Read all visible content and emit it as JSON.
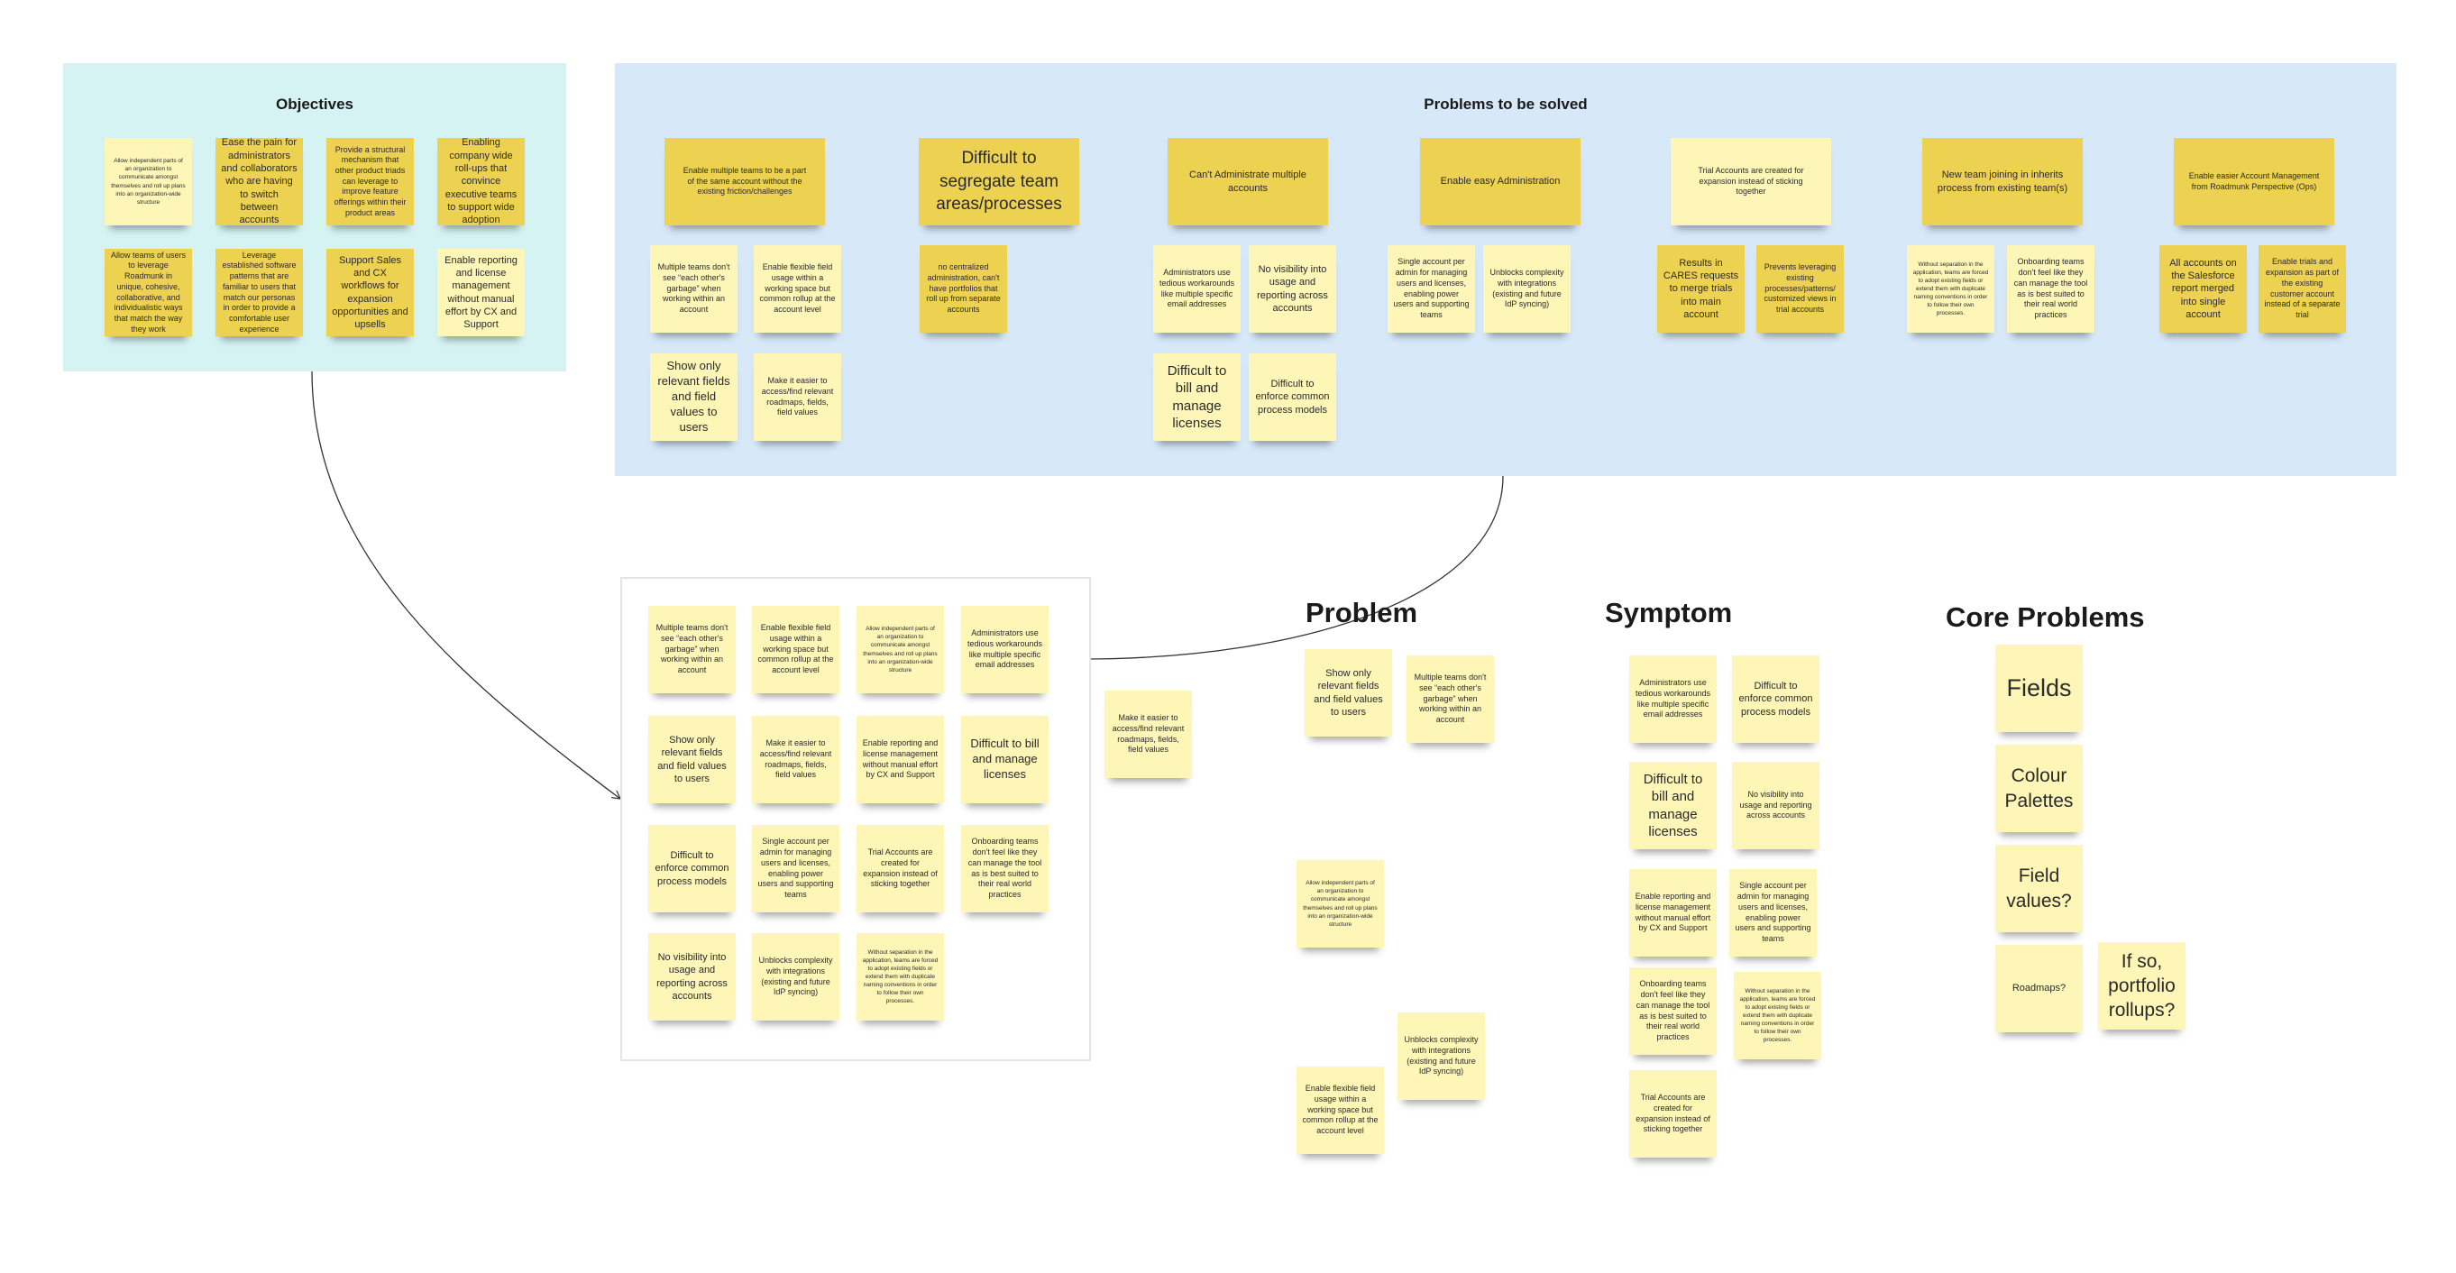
{
  "objectives": {
    "title": "Objectives",
    "notes": [
      "Allow independent parts of an organization to communicate amongst themselves and roll up plans into an organization-wide structure",
      "Ease the pain for administrators and collaborators who are having to switch between accounts",
      "Provide a structural mechanism that other product triads can leverage to improve feature offerings within their product areas",
      "Enabling company wide roll-ups that convince executive teams to support wide adoption",
      "Allow teams of users to leverage Roadmunk in unique, cohesive, collaborative, and individualistic ways that match the way they work",
      "Leverage established software patterns that are familiar to users that match our personas in order to provide a comfortable user experience",
      "Support Sales and CX workflows for expansion opportunities and upsells",
      "Enable reporting and license management without manual effort by CX and Support"
    ]
  },
  "problems": {
    "title": "Problems to be solved",
    "groups": [
      {
        "header": "Enable multiple teams to be a part of the same account without the existing friction/challenges",
        "notes": [
          "Multiple teams don't see “each other's garbage” when working within an account",
          "Enable flexible field usage within a working space but common rollup at the account level",
          "Show only relevant fields and field values to users",
          "Make it easier to access/find relevant roadmaps, fields, field values"
        ]
      },
      {
        "header": "Difficult to segregate team areas/processes",
        "notes": [
          "no centralized administration, can't have portfolios that roll up from separate accounts"
        ]
      },
      {
        "header": "Can't Administrate multiple accounts",
        "notes": [
          "Administrators use tedious workarounds like multiple specific email addresses",
          "No visibility into usage and reporting across accounts",
          "Difficult to bill and manage licenses",
          "Difficult to enforce common process models"
        ]
      },
      {
        "header": "Enable easy Administration",
        "notes": [
          "Single account per admin for managing users and licenses, enabling power users and supporting teams",
          "Unblocks complexity with integrations (existing and future IdP syncing)"
        ]
      },
      {
        "header": "Trial Accounts are created for expansion instead of sticking together",
        "notes": [
          "Results in CARES requests to merge trials into main account",
          "Prevents leveraging existing processes/patterns/ customized views in trial accounts"
        ]
      },
      {
        "header": "New team joining in inherits process from existing team(s)",
        "notes": [
          "Without separation in the application, teams are forced to adopt existing fields or extend them with duplicate naming conventions in order to follow their own processes.",
          "Onboarding teams don't feel like they can manage the tool as is best suited to their real world practices"
        ]
      },
      {
        "header": "Enable easier Account Management from Roadmunk Perspective (Ops)",
        "notes": [
          "All accounts on the Salesforce report merged into single account",
          "Enable trials and expansion as part of the existing customer account instead of a separate trial"
        ]
      }
    ]
  },
  "cluster": {
    "notes": [
      "Multiple teams don't see “each other's garbage” when working within an account",
      "Enable flexible field usage within a working space but common rollup at the account level",
      "Allow independent parts of an organization to communicate amongst themselves and roll up plans into an organization-wide structure",
      "Administrators use tedious workarounds like multiple specific email addresses",
      "Show only relevant fields and field values to users",
      "Make it easier to access/find relevant roadmaps, fields, field values",
      "Enable reporting and license management without manual effort by CX and Support",
      "Difficult to bill and manage licenses",
      "Difficult to enforce common process models",
      "Single account per admin for managing users and licenses, enabling power users and supporting teams",
      "Trial Accounts are created for expansion instead of sticking together",
      "Onboarding teams don't feel like they can manage the tool as is best suited to their real world practices",
      "No visibility into usage and reporting across accounts",
      "Unblocks complexity with integrations (existing and future IdP syncing)",
      "Without separation in the application, teams are forced to adopt existing fields or extend them with duplicate naming conventions in order to follow their own processes."
    ],
    "loose_note": "Make it easier to access/find relevant roadmaps, fields, field values"
  },
  "problem_column": {
    "title": "Problem",
    "notes": [
      "Show only relevant fields and field values to users",
      "Multiple teams don't see “each other's garbage” when working within an account",
      "Allow independent parts of an organization to communicate amongst themselves and roll up plans into an organization-wide structure",
      "Unblocks complexity with integrations (existing and future IdP syncing)",
      "Enable flexible field usage within a working space but common rollup at the account level"
    ]
  },
  "symptom_column": {
    "title": "Symptom",
    "notes": [
      "Administrators use tedious workarounds like multiple specific email addresses",
      "Difficult to enforce common process models",
      "Difficult to bill and manage licenses",
      "No visibility into usage and reporting across accounts",
      "Enable reporting and license management without manual effort by CX and Support",
      "Single account per admin for managing users and licenses, enabling power users and supporting teams",
      "Onboarding teams don't feel like they can manage the tool as is best suited to their real world practices",
      "Without separation in the application, teams are forced to adopt existing fields or extend them with duplicate naming conventions in order to follow their own processes.",
      "Trial Accounts are created for expansion instead of sticking together"
    ]
  },
  "core_problems": {
    "title": "Core Problems",
    "notes": [
      "Fields",
      "Colour Palettes",
      "Field values?",
      "Roadmaps?",
      "If so, portfolio rollups?"
    ]
  },
  "colors": {
    "sticky_light": "#fdf6b7",
    "sticky_dark": "#edd150",
    "objectives_frame": "#d6f3f3",
    "problems_frame": "#d7e8f8",
    "connector": "#333333"
  }
}
